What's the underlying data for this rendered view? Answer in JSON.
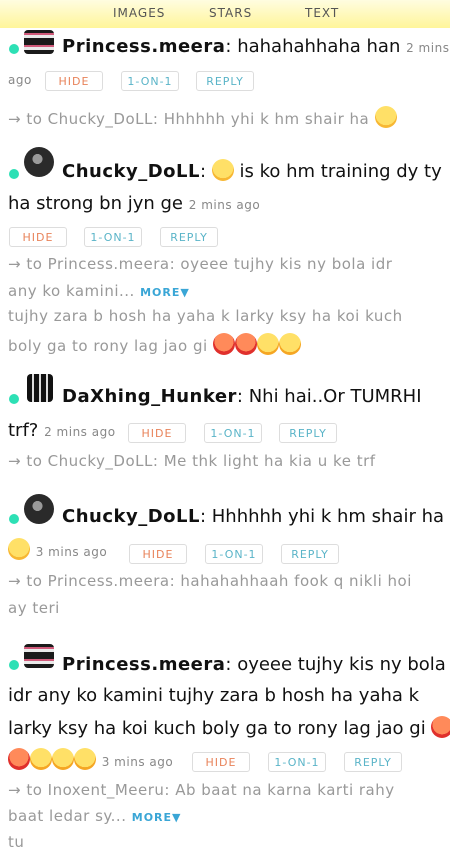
{
  "tabs": {
    "images": "IMAGES",
    "stars": "STARS",
    "text": "TEXT"
  },
  "buttons": {
    "hide": "HIDE",
    "one_on_one": "1-ON-1",
    "reply": "REPLY"
  },
  "more_label": "MORE▼",
  "posts": [
    {
      "username": "Princess.meera",
      "message_l1": ": hahahahhaha han",
      "time": "2 mins",
      "time_l2": "ago",
      "reply_to": "→ to Chucky_DoLL: Hhhhhh yhi k hm shair ha",
      "reply_icons": [
        "laugh"
      ]
    },
    {
      "username": "Chucky_DoLL",
      "message_l1": ":",
      "message_l1b": "is ko hm training dy ty",
      "message_l2": "ha strong bn jyn ge",
      "time": "2 mins ago",
      "reply_l1": "→ to Princess.meera: oyeee tujhy kis ny bola idr",
      "reply_l2": "any ko kamini...",
      "reply_l3": "tujhy zara b hosh ha yaha k larky ksy ha koi kuch",
      "reply_l4": "boly ga to rony lag jao gi",
      "message_icons": [
        "laugh"
      ],
      "reply_icons": [
        "angry",
        "angry",
        "steam",
        "steam"
      ]
    },
    {
      "username": "DaXhing_Hunker",
      "message_l1": ": Nhi hai..Or TUMRHI",
      "message_l2": "trf?",
      "time": "2 mins ago",
      "reply_to": "→ to Chucky_DoLL: Me thk light ha kia u ke trf"
    },
    {
      "username": "Chucky_DoLL",
      "message_l1": ": Hhhhhh yhi k hm shair ha",
      "time": "3 mins ago",
      "reply_l1": "→ to Princess.meera: hahahahhaah fook q nikli hoi",
      "reply_l2": "ay teri",
      "message_icons": [
        "laugh"
      ]
    },
    {
      "username": "Princess.meera",
      "message_l1": ": oyeee tujhy kis ny bola",
      "message_l2": "idr any ko kamini tujhy zara b hosh ha yaha k",
      "message_l3": "larky ksy ha koi kuch boly ga to rony lag jao gi",
      "time": "3 mins ago",
      "reply_l1": "→ to Inoxent_Meeru: Ab baat na karna karti rahy",
      "reply_l2": "baat ledar sy...",
      "reply_l3": "tu",
      "message_icons": [
        "angry",
        "angry",
        "steam",
        "steam",
        "steam"
      ]
    }
  ]
}
